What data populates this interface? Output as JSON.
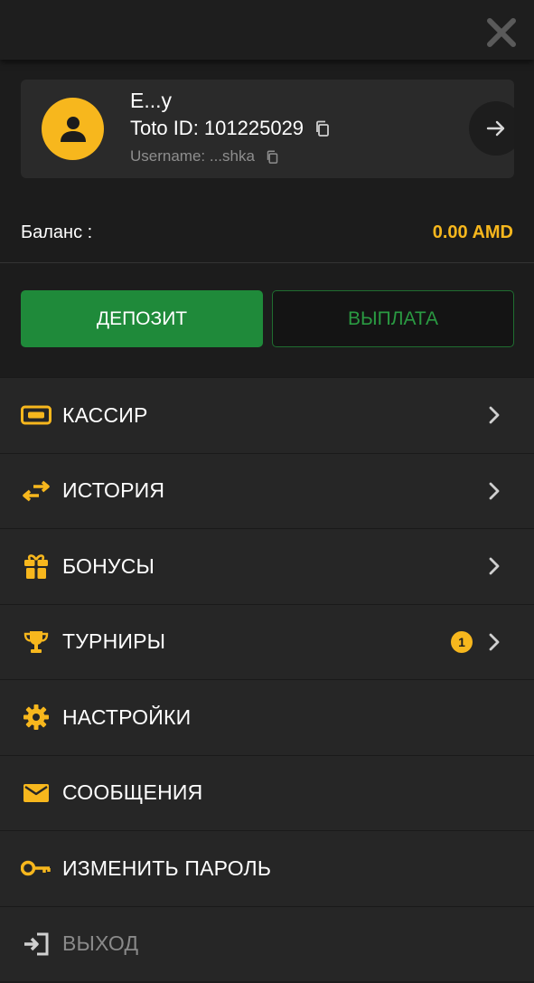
{
  "header": {
    "close_icon": "close-icon"
  },
  "profile": {
    "name": "E...y",
    "toto_id_label": "Toto ID: 101225029",
    "username_label": "Username: ...shka",
    "avatar_icon": "user-icon",
    "copy_icon": "copy-icon",
    "arrow_icon": "arrow-right-icon"
  },
  "balance": {
    "label": "Баланс :",
    "value": "0.00 AMD"
  },
  "actions": {
    "deposit": "ДЕПОЗИТ",
    "withdraw": "ВЫПЛАТА"
  },
  "menu": [
    {
      "label": "КАССИР",
      "icon": "cash-icon",
      "chevron": true
    },
    {
      "label": "ИСТОРИЯ",
      "icon": "swap-arrows-icon",
      "chevron": true
    },
    {
      "label": "БОНУСЫ",
      "icon": "gift-icon",
      "chevron": true
    },
    {
      "label": "ТУРНИРЫ",
      "icon": "trophy-icon",
      "chevron": true,
      "badge": "1"
    },
    {
      "label": "НАСТРОЙКИ",
      "icon": "gear-icon",
      "chevron": false
    },
    {
      "label": "СООБЩЕНИЯ",
      "icon": "envelope-icon",
      "chevron": false
    },
    {
      "label": "ИЗМЕНИТЬ ПАРОЛЬ",
      "icon": "key-icon",
      "chevron": false
    },
    {
      "label": "ВЫХОД",
      "icon": "logout-icon",
      "chevron": false
    }
  ],
  "colors": {
    "accent": "#f7b71d",
    "primary_green": "#1f8a3a",
    "background": "#1c1c1c",
    "row": "#262626"
  }
}
